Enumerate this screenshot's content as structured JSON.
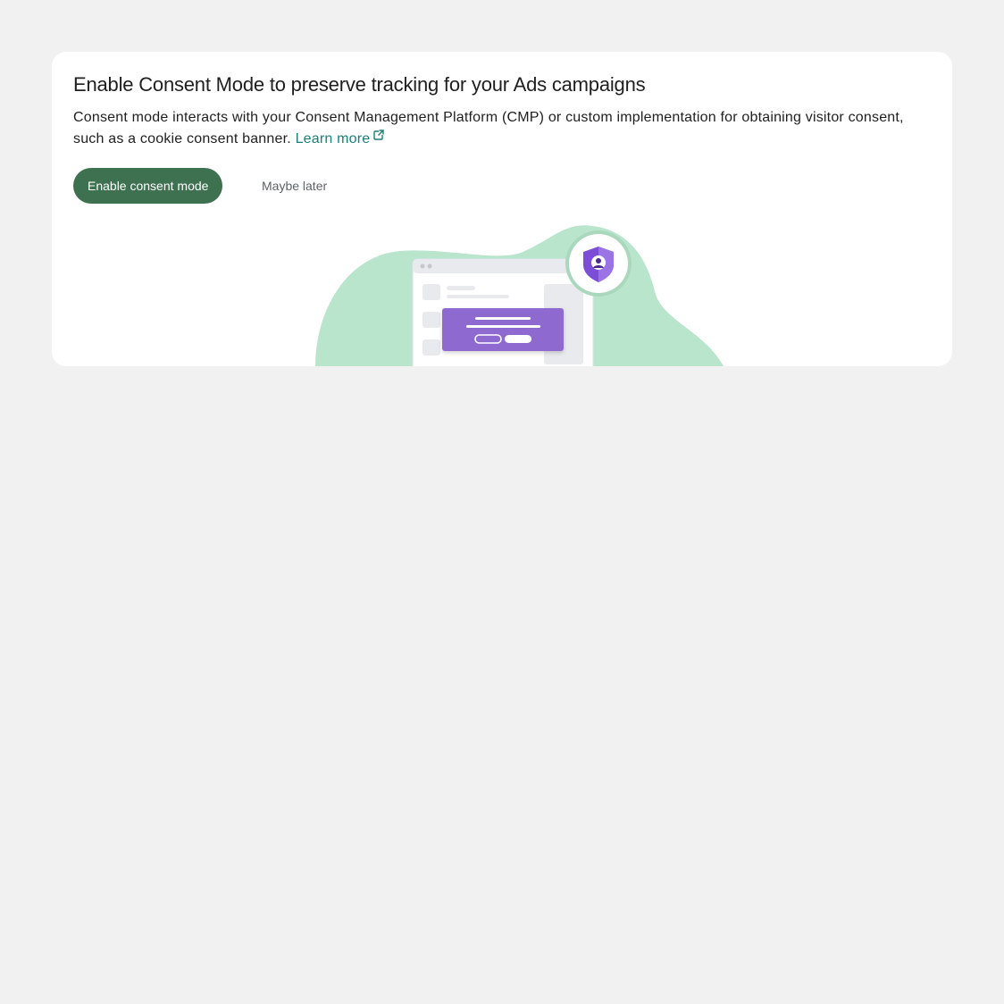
{
  "card": {
    "title": "Enable Consent Mode to preserve tracking for your Ads campaigns",
    "description": "Consent mode interacts with your Consent Management Platform (CMP) or custom implementation for obtaining visitor consent, such as a cookie consent banner.",
    "learn_more": "Learn more",
    "learn_more_icon": "open-in-new-icon"
  },
  "actions": {
    "primary_label": "Enable consent mode",
    "secondary_label": "Maybe later"
  },
  "illustration": {
    "icon": "privacy-shield-icon"
  },
  "colors": {
    "background": "#f1f1f1",
    "card": "#ffffff",
    "primary_button": "#3d7150",
    "link": "#1a7f7a",
    "blob": "#b9e5cd",
    "banner": "#8e6bd0",
    "shield": "#7c4dd6"
  }
}
